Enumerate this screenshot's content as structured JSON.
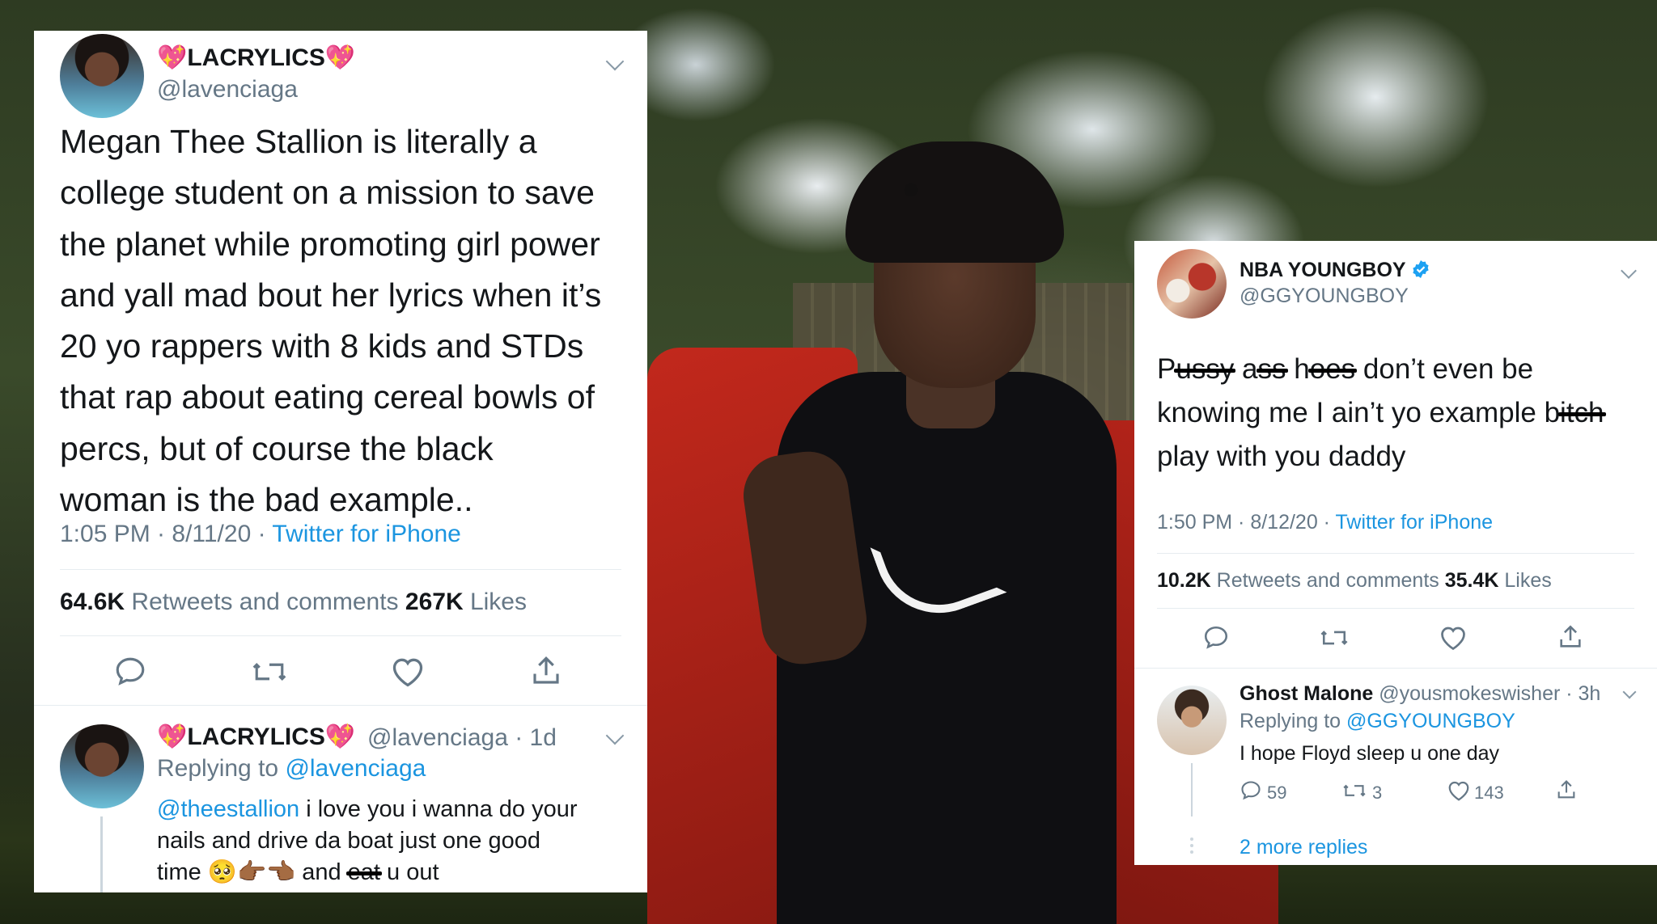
{
  "tweet_left": {
    "display_name": "LACRYLICS",
    "name_decoration": "💖",
    "handle": "@lavenciaga",
    "text_lines": [
      "Megan Thee Stallion is literally a",
      "college student on a mission to save",
      "the planet while promoting girl power",
      "and yall mad bout her lyrics when it’s",
      "20 yo rappers with 8 kids and STDs",
      "that rap about eating cereal bowls of",
      "percs, but of course the black",
      "woman is the bad example.."
    ],
    "time": "1:05 PM · 8/11/20 · ",
    "source": "Twitter for iPhone",
    "retweets_count": "64.6K",
    "retweets_label": " Retweets and comments ",
    "likes_count": "267K",
    "likes_label": " Likes",
    "reply": {
      "display_name": "LACRYLICS",
      "handle_time": "@lavenciaga · 1d",
      "replying_prefix": "Replying to ",
      "replying_handle": "@lavenciaga",
      "mention": "@theestallion",
      "line1_rest": " i love you i wanna do your",
      "line2": "nails and drive da boat just one good",
      "line3_start": "time ",
      "emojis": "🥺👉🏾👈🏾",
      "line3_and": " and ",
      "line3_struck": "eat",
      "line3_end": " u out"
    }
  },
  "tweet_right": {
    "display_name": "NBA YOUNGBOY",
    "handle": "@GGYOUNGBOY",
    "verified_color": "#1da1f2",
    "line1": {
      "p": "P",
      "s1": "ussy",
      "a": " a",
      "s2": "ss",
      "h": " h",
      "s3": "oes",
      "rest": " don’t even be"
    },
    "line2": {
      "start": "knowing  me I ain’t yo example ",
      "b": "b",
      "s4": "itch"
    },
    "line3": "play with you daddy",
    "time": "1:50 PM · 8/12/20 · ",
    "source": "Twitter for iPhone",
    "retweets_count": "10.2K",
    "retweets_label": " Retweets and comments ",
    "likes_count": "35.4K",
    "likes_label": " Likes",
    "reply": {
      "display_name": "Ghost Malone",
      "handle_time": " @yousmokeswisher · 3h",
      "replying_prefix": "Replying to ",
      "replying_handle": "@GGYOUNGBOY",
      "text": "I hope Floyd sleep u one day",
      "comments": "59",
      "retweets": "3",
      "likes": "143",
      "more_replies": "2 more replies"
    }
  },
  "colors": {
    "link": "#1b95e0",
    "muted": "#657786",
    "text": "#14171a",
    "heart": "#e0245e"
  }
}
